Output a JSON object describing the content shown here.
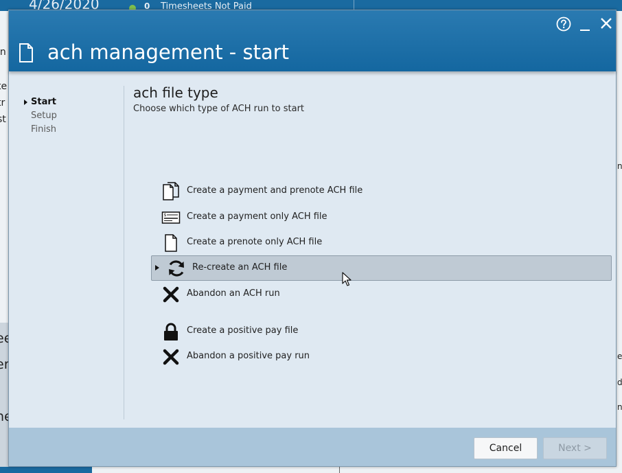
{
  "background": {
    "date": "4/26/2020",
    "notice_count": "0",
    "notice_text": "Timesheets Not Paid",
    "left_fragments": [
      "in",
      "te",
      "tr",
      "st",
      "ee",
      "er",
      "ne"
    ],
    "right_fragments": [
      "n",
      "ns",
      "es",
      "d",
      "n",
      "i"
    ]
  },
  "dialog": {
    "title": "ach management - start",
    "steps": [
      {
        "label": "Start",
        "active": true
      },
      {
        "label": "Setup",
        "active": false
      },
      {
        "label": "Finish",
        "active": false
      }
    ],
    "section_title": "ach file type",
    "section_subtitle": "Choose which type of ACH run to start",
    "options": [
      {
        "label": "Create a payment and prenote ACH file",
        "icon": "documents-icon",
        "selected": false
      },
      {
        "label": "Create a payment only ACH file",
        "icon": "check-payment-icon",
        "selected": false
      },
      {
        "label": "Create a prenote only ACH file",
        "icon": "document-icon",
        "selected": false
      },
      {
        "label": "Re-create an ACH file",
        "icon": "refresh-icon",
        "selected": true
      },
      {
        "label": "Abandon an ACH run",
        "icon": "x-icon",
        "selected": false
      },
      {
        "label": "Create a positive pay file",
        "icon": "lock-icon",
        "selected": false
      },
      {
        "label": "Abandon a positive pay run",
        "icon": "x-icon",
        "selected": false
      }
    ],
    "buttons": {
      "cancel": "Cancel",
      "next": "Next >"
    },
    "next_enabled": false
  },
  "colors": {
    "titlebar": "#1467a0",
    "panel": "#dfe9f2",
    "footer": "#a9c5da",
    "selected_row": "#bfcad4"
  }
}
